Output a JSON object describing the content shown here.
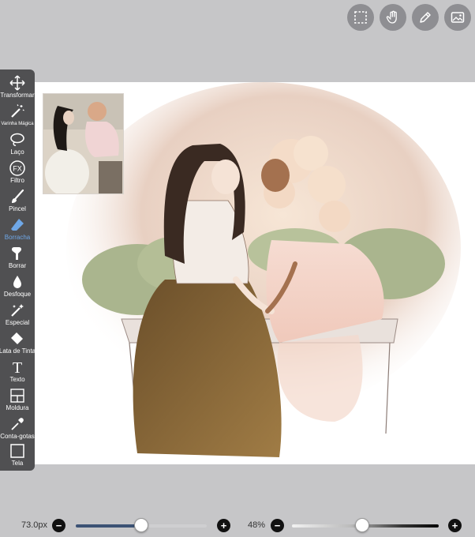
{
  "top_bar": {
    "buttons": [
      {
        "name": "selection-button",
        "icon": "dashed-square-icon"
      },
      {
        "name": "gesture-button",
        "icon": "hand-icon"
      },
      {
        "name": "adjust-button",
        "icon": "pencil-icon"
      },
      {
        "name": "gallery-button",
        "icon": "image-icon"
      }
    ]
  },
  "toolbar": {
    "items": [
      {
        "label": "Transformar",
        "icon": "move-icon"
      },
      {
        "label": "Varinha Mágica",
        "icon": "magic-wand-icon"
      },
      {
        "label": "Laço",
        "icon": "lasso-icon"
      },
      {
        "label": "Filtro",
        "icon": "fx-icon",
        "icon_text": "FX"
      },
      {
        "label": "Pincel",
        "icon": "brush-icon"
      },
      {
        "label": "Borracha",
        "icon": "eraser-icon",
        "active": true
      },
      {
        "label": "Borrar",
        "icon": "smudge-icon"
      },
      {
        "label": "Desfoque",
        "icon": "blur-icon"
      },
      {
        "label": "Especial",
        "icon": "special-icon"
      },
      {
        "label": "Lata de Tinta",
        "icon": "paint-bucket-icon"
      },
      {
        "label": "Texto",
        "icon": "text-icon",
        "icon_text": "T"
      },
      {
        "label": "Moldura",
        "icon": "frame-icon"
      },
      {
        "label": "Conta-gotas",
        "icon": "eyedropper-icon"
      },
      {
        "label": "Tela",
        "icon": "canvas-icon"
      }
    ],
    "active_color": "#6fa8e8"
  },
  "bottom_bar": {
    "size_value": "73.0px",
    "size_slider_fraction": 0.5,
    "opacity_value": "48%",
    "opacity_slider_fraction": 0.48,
    "minus_symbol": "−",
    "plus_symbol": "+"
  }
}
